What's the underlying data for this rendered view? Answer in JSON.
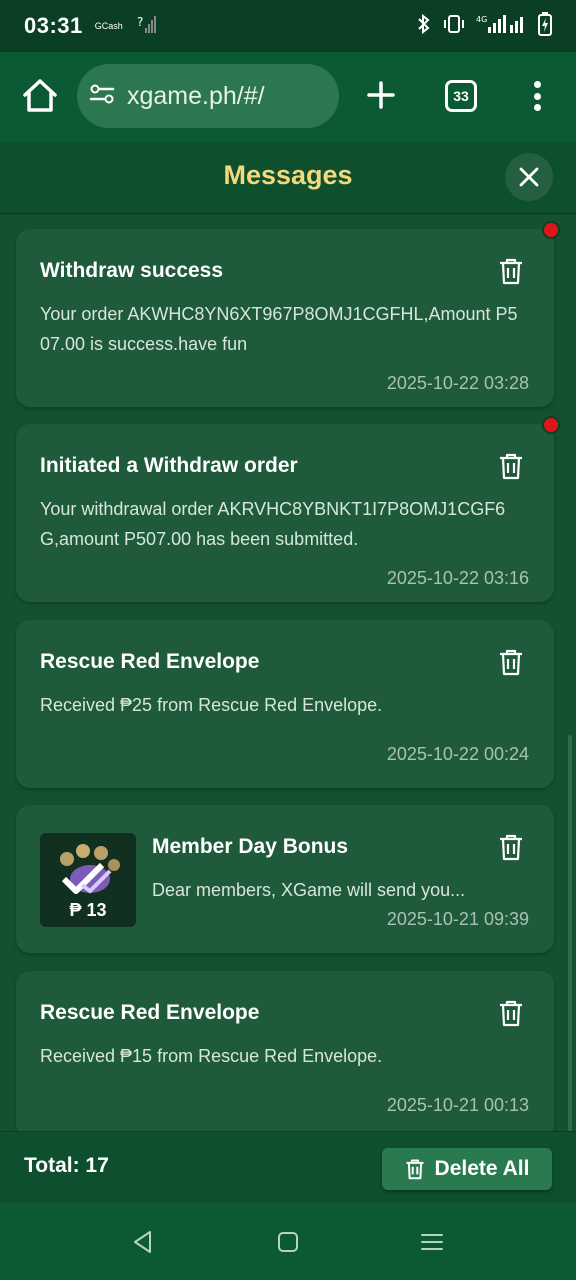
{
  "status_bar": {
    "time": "03:31",
    "carrier_label": "GCash",
    "signal_left": "?",
    "network": "4G"
  },
  "browser": {
    "url": "xgame.ph/#/",
    "tab_count": "33"
  },
  "header": {
    "title": "Messages"
  },
  "messages": [
    {
      "title": "Withdraw success",
      "body": "Your order AKWHC8YN6XT967P8OMJ1CGFHL,Amount P507.00 is success.have fun",
      "time": "2025-10-22 03:28",
      "unread": true
    },
    {
      "title": "Initiated a Withdraw order",
      "body": "Your withdrawal order AKRVHC8YBNKT1I7P8OMJ1CGF6G,amount P507.00 has been submitted.",
      "time": "2025-10-22 03:16",
      "unread": true
    },
    {
      "title": "Rescue Red Envelope",
      "body": "Received ₱25 from Rescue Red Envelope.",
      "time": "2025-10-22 00:24",
      "unread": false
    },
    {
      "title": "Member Day Bonus",
      "body": "Dear members, XGame will send you...",
      "time": "2025-10-21 09:39",
      "thumb_amount": "₱ 13",
      "unread": false
    },
    {
      "title": "Rescue Red Envelope",
      "body": "Received ₱15 from Rescue Red Envelope.",
      "time": "2025-10-21 00:13",
      "unread": false
    }
  ],
  "footer": {
    "total_label": "Total: 17",
    "delete_all_label": "Delete All"
  },
  "colors": {
    "title_gold": "#f4d97a",
    "card_bg": "#1f5a3a",
    "unread_red": "#e0151a"
  }
}
